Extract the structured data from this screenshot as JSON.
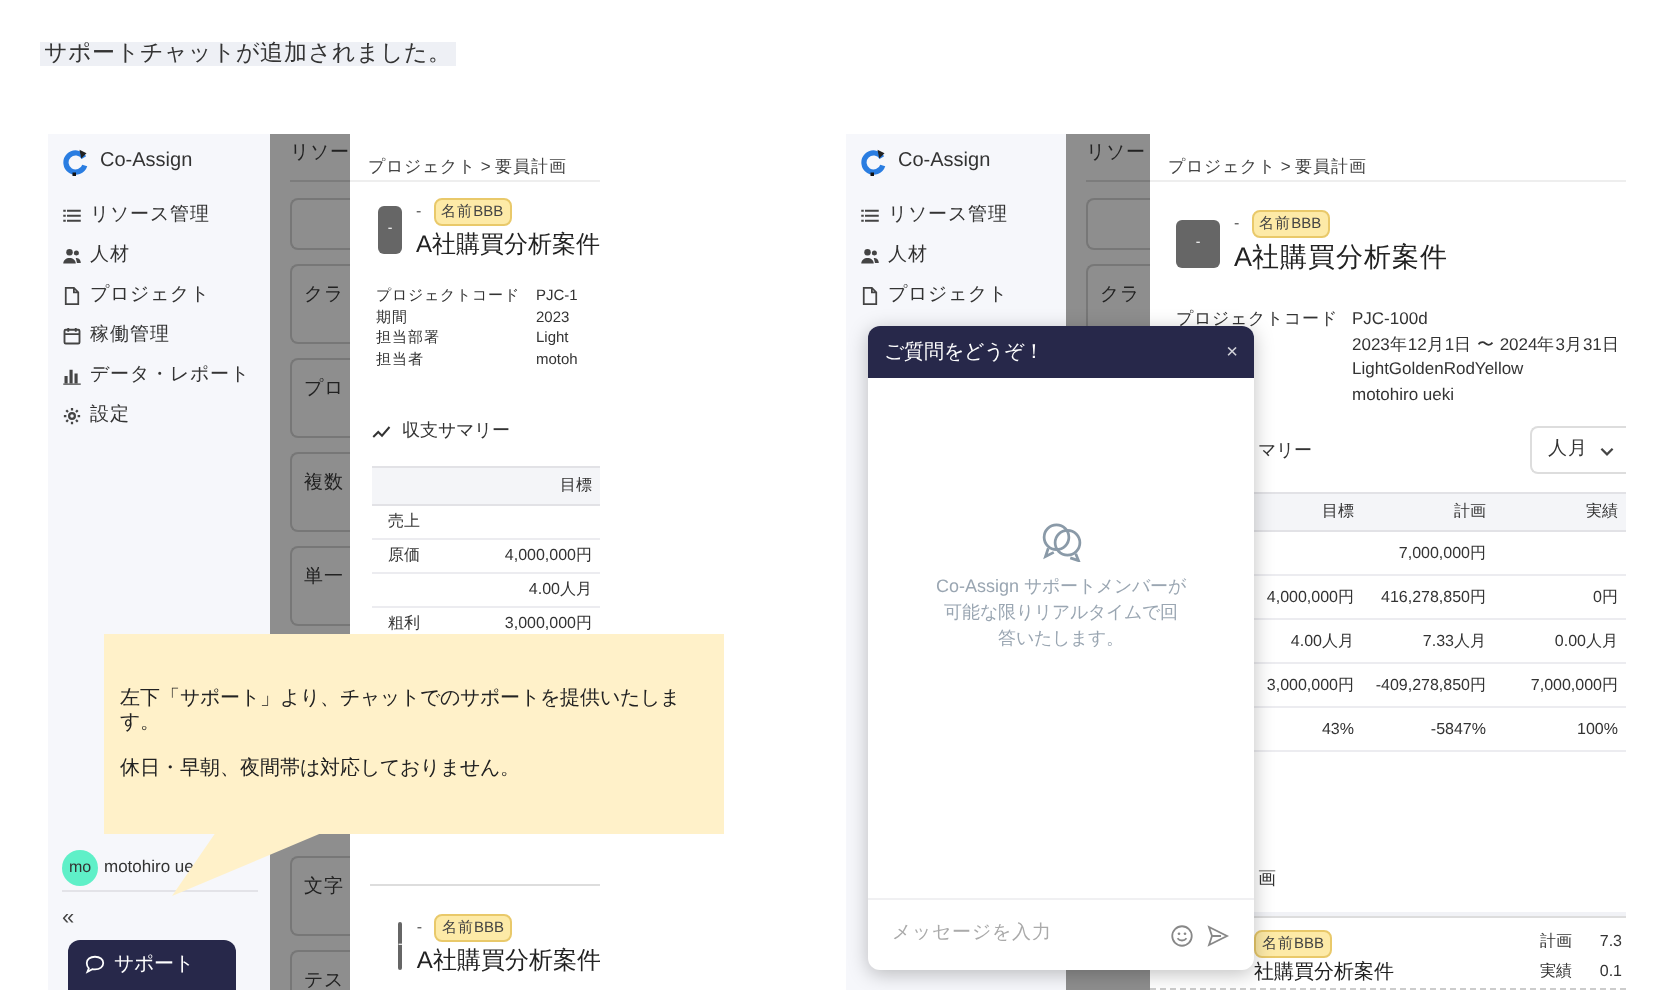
{
  "caption": "サポートチャットが追加されました。",
  "left_screen": {
    "sidebar": {
      "logo": "Co-Assign",
      "items": [
        {
          "label": "リソース管理"
        },
        {
          "label": "人材"
        },
        {
          "label": "プロジェクト"
        },
        {
          "label": "稼働管理"
        },
        {
          "label": "データ・レポート"
        },
        {
          "label": "設定"
        }
      ],
      "user": {
        "initials": "mo",
        "name": "motohiro ue"
      },
      "collapse": "«",
      "support_button": "サポート"
    },
    "list_column": {
      "title": "リソー",
      "cards_top": [
        {
          "kind": "blank"
        },
        {
          "kind": "text",
          "text": "クラ"
        },
        {
          "kind": "text",
          "text": "プロ"
        },
        {
          "kind": "text",
          "text": "複数"
        },
        {
          "kind": "text",
          "text": "単一"
        }
      ],
      "cards_bottom": [
        {
          "kind": "text",
          "text": "文字"
        },
        {
          "kind": "text",
          "text": "テス"
        }
      ]
    },
    "detail": {
      "breadcrumb": "プロジェクト > 要員計画",
      "avatar": "-",
      "subtitle": "-",
      "tag": "名前BBB",
      "title": "A社購買分析案件",
      "fields": [
        {
          "label": "プロジェクトコード",
          "value": "PJC-1"
        },
        {
          "label": "期間",
          "value": "2023"
        },
        {
          "label": "担当部署",
          "value": "Light"
        },
        {
          "label": "担当者",
          "value": "motoh"
        }
      ],
      "summary_title": "収支サマリー",
      "table": {
        "columns": [
          "目標"
        ],
        "rows": [
          {
            "label": "売上",
            "cells": [
              null
            ]
          },
          {
            "label": "原価",
            "cells": [
              "4,000,000円"
            ]
          },
          {
            "cells": [
              "4.00人月"
            ]
          },
          {
            "label": "粗利",
            "cells": [
              "3,000,000円"
            ]
          }
        ]
      },
      "bottom_card": {
        "avatar": "-",
        "subtitle": "-",
        "tag": "名前BBB",
        "title": "A社購買分析案件"
      }
    }
  },
  "callout": {
    "lines": [
      "左下「サポート」より、チャットでのサポートを提供いたします。",
      "休日・早朝、夜間帯は対応しておりません。"
    ]
  },
  "right_screen": {
    "sidebar": {
      "logo": "Co-Assign",
      "items": [
        {
          "label": "リソース管理"
        },
        {
          "label": "人材"
        },
        {
          "label": "プロジェクト"
        }
      ]
    },
    "list_column": {
      "title": "リソー",
      "cards_top": [
        {
          "kind": "blank"
        },
        {
          "kind": "text",
          "text": "クラ"
        }
      ]
    },
    "detail": {
      "breadcrumb": "プロジェクト > 要員計画",
      "avatar": "-",
      "subtitle": "-",
      "tag": "名前BBB",
      "title": "A社購買分析案件",
      "fields": [
        {
          "label": "プロジェクトコード",
          "value": "PJC-100d"
        },
        {
          "value": "2023年12月1日 〜 2024年3月31日"
        },
        {
          "value": "LightGoldenRodYellow"
        },
        {
          "value": "motohiro ueki"
        }
      ],
      "summary_title": "マリー",
      "unit_select": "人月",
      "table": {
        "columns": [
          "目標",
          "計画",
          "実績"
        ],
        "rows": [
          {
            "cells": [
              null,
              "7,000,000円",
              null
            ]
          },
          {
            "cells": [
              "4,000,000円",
              "416,278,850円",
              "0円"
            ]
          },
          {
            "cells": [
              "4.00人月",
              "7.33人月",
              "0.00人月"
            ]
          },
          {
            "cells": [
              "3,000,000円",
              "-409,278,850円",
              "7,000,000円"
            ]
          },
          {
            "cells": [
              "43%",
              "-5847%",
              "100%"
            ]
          }
        ]
      },
      "section_title": "画",
      "bottom_card": {
        "tag": "名前BBB",
        "title": "社購買分析案件",
        "metrics": [
          {
            "label": "計画",
            "value": "7.3"
          },
          {
            "label": "実績",
            "value": "0.1"
          }
        ]
      }
    }
  },
  "chat": {
    "title": "ご質問をどうぞ！",
    "close": "×",
    "message": "Co-Assign サポートメンバーが可能な限りリアルタイムで回答いたします。",
    "placeholder": "メッセージを入力"
  }
}
